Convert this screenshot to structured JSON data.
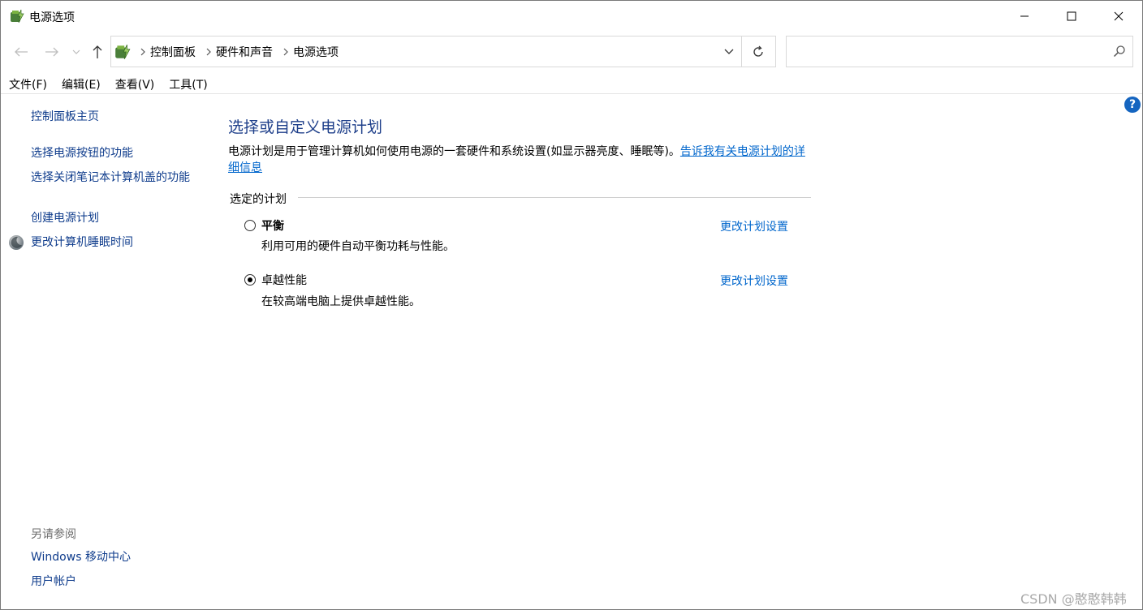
{
  "window": {
    "title": "电源选项",
    "controls": {
      "minimize": "minimize",
      "maximize": "maximize",
      "close": "close"
    }
  },
  "address_bar": {
    "breadcrumbs": [
      "控制面板",
      "硬件和声音",
      "电源选项"
    ]
  },
  "search": {
    "value": "",
    "placeholder": ""
  },
  "menu": [
    "文件(F)",
    "编辑(E)",
    "查看(V)",
    "工具(T)"
  ],
  "sidebar": {
    "home": "控制面板主页",
    "items": [
      "选择电源按钮的功能",
      "选择关闭笔记本计算机盖的功能",
      "创建电源计划",
      "更改计算机睡眠时间"
    ],
    "see_also_label": "另请参阅",
    "see_also": [
      "Windows 移动中心",
      "用户帐户"
    ]
  },
  "main": {
    "title": "选择或自定义电源计划",
    "description": "电源计划是用于管理计算机如何使用电源的一套硬件和系统设置(如显示器亮度、睡眠等)。",
    "description_link": "告诉我有关电源计划的详细信息",
    "group_label": "选定的计划",
    "plans": [
      {
        "name": "平衡",
        "description": "利用可用的硬件自动平衡功耗与性能。",
        "link": "更改计划设置",
        "selected": false
      },
      {
        "name": "卓越性能",
        "description": "在较高端电脑上提供卓越性能。",
        "link": "更改计划设置",
        "selected": true
      }
    ]
  },
  "help_glyph": "?",
  "watermark": "CSDN @憨憨韩韩",
  "colors": {
    "link": "#0066cc",
    "title": "#1e3f8a",
    "help": "#1565c0"
  }
}
